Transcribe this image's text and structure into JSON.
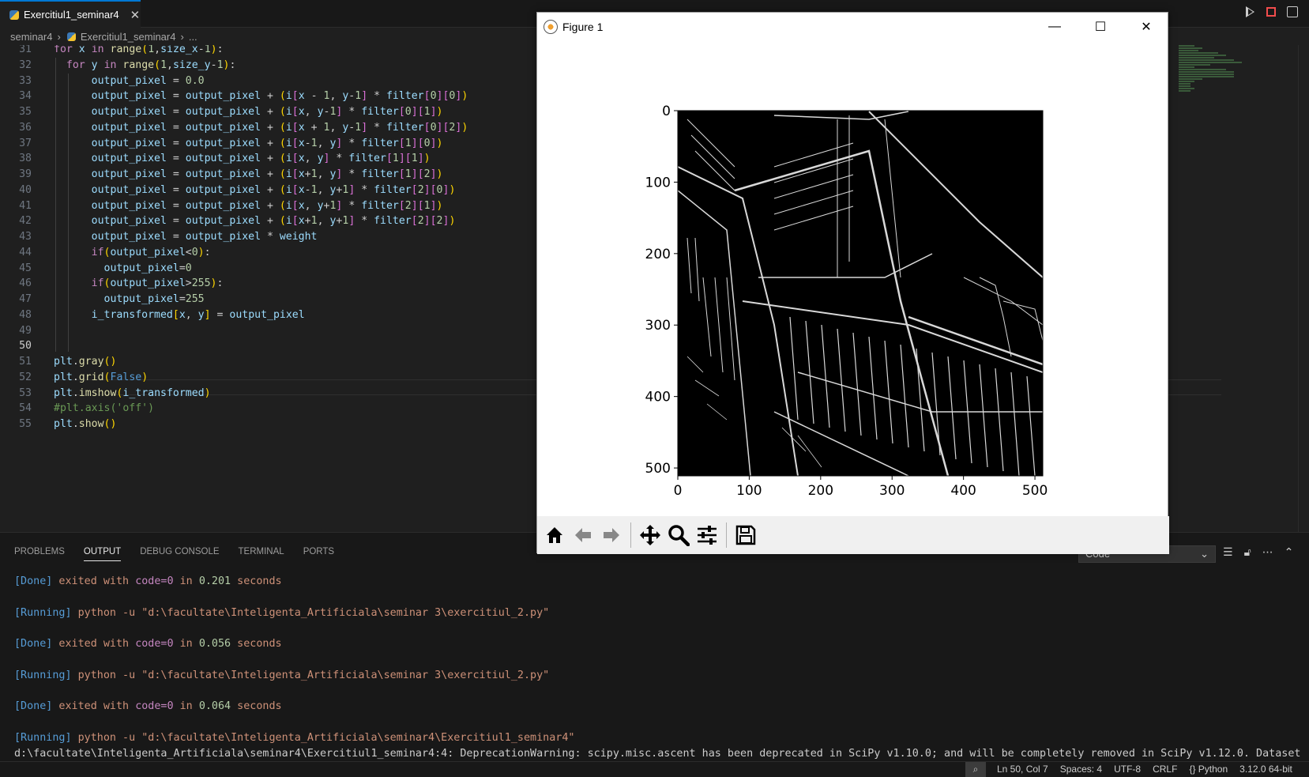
{
  "tab": {
    "label": "Exercitiul1_seminar4",
    "close": "✕"
  },
  "breadcrumbs": {
    "folder": "seminar4",
    "file": "Exercitiul1_seminar4",
    "more": "..."
  },
  "code_lines": [
    {
      "n": "31",
      "html": "<span class='k'>for</span> <span class='v'>x</span> <span class='k'>in</span> <span class='fn'>range</span><span class='p1'>(</span><span class='n'>1</span>,<span class='v'>size_x</span>-<span class='n'>1</span><span class='p1'>)</span>:"
    },
    {
      "n": "32",
      "html": "  <span class='k'>for</span> <span class='v'>y</span> <span class='k'>in</span> <span class='fn'>range</span><span class='p1'>(</span><span class='n'>1</span>,<span class='v'>size_y</span>-<span class='n'>1</span><span class='p1'>)</span>:"
    },
    {
      "n": "33",
      "html": "      <span class='v'>output_pixel</span> = <span class='n'>0.0</span>"
    },
    {
      "n": "34",
      "html": "      <span class='v'>output_pixel</span> = <span class='v'>output_pixel</span> + <span class='p1'>(</span><span class='v'>i</span><span class='p2'>[</span><span class='v'>x</span> - <span class='n'>1</span>, <span class='v'>y</span>-<span class='n'>1</span><span class='p2'>]</span> * <span class='v'>filter</span><span class='p2'>[</span><span class='n'>0</span><span class='p2'>][</span><span class='n'>0</span><span class='p2'>]</span><span class='p1'>)</span>"
    },
    {
      "n": "35",
      "html": "      <span class='v'>output_pixel</span> = <span class='v'>output_pixel</span> + <span class='p1'>(</span><span class='v'>i</span><span class='p2'>[</span><span class='v'>x</span>, <span class='v'>y</span>-<span class='n'>1</span><span class='p2'>]</span> * <span class='v'>filter</span><span class='p2'>[</span><span class='n'>0</span><span class='p2'>][</span><span class='n'>1</span><span class='p2'>]</span><span class='p1'>)</span>"
    },
    {
      "n": "36",
      "html": "      <span class='v'>output_pixel</span> = <span class='v'>output_pixel</span> + <span class='p1'>(</span><span class='v'>i</span><span class='p2'>[</span><span class='v'>x</span> + <span class='n'>1</span>, <span class='v'>y</span>-<span class='n'>1</span><span class='p2'>]</span> * <span class='v'>filter</span><span class='p2'>[</span><span class='n'>0</span><span class='p2'>][</span><span class='n'>2</span><span class='p2'>]</span><span class='p1'>)</span>"
    },
    {
      "n": "37",
      "html": "      <span class='v'>output_pixel</span> = <span class='v'>output_pixel</span> + <span class='p1'>(</span><span class='v'>i</span><span class='p2'>[</span><span class='v'>x</span>-<span class='n'>1</span>, <span class='v'>y</span><span class='p2'>]</span> * <span class='v'>filter</span><span class='p2'>[</span><span class='n'>1</span><span class='p2'>][</span><span class='n'>0</span><span class='p2'>]</span><span class='p1'>)</span>"
    },
    {
      "n": "38",
      "html": "      <span class='v'>output_pixel</span> = <span class='v'>output_pixel</span> + <span class='p1'>(</span><span class='v'>i</span><span class='p2'>[</span><span class='v'>x</span>, <span class='v'>y</span><span class='p2'>]</span> * <span class='v'>filter</span><span class='p2'>[</span><span class='n'>1</span><span class='p2'>][</span><span class='n'>1</span><span class='p2'>]</span><span class='p1'>)</span>"
    },
    {
      "n": "39",
      "html": "      <span class='v'>output_pixel</span> = <span class='v'>output_pixel</span> + <span class='p1'>(</span><span class='v'>i</span><span class='p2'>[</span><span class='v'>x</span>+<span class='n'>1</span>, <span class='v'>y</span><span class='p2'>]</span> * <span class='v'>filter</span><span class='p2'>[</span><span class='n'>1</span><span class='p2'>][</span><span class='n'>2</span><span class='p2'>]</span><span class='p1'>)</span>"
    },
    {
      "n": "40",
      "html": "      <span class='v'>output_pixel</span> = <span class='v'>output_pixel</span> + <span class='p1'>(</span><span class='v'>i</span><span class='p2'>[</span><span class='v'>x</span>-<span class='n'>1</span>, <span class='v'>y</span>+<span class='n'>1</span><span class='p2'>]</span> * <span class='v'>filter</span><span class='p2'>[</span><span class='n'>2</span><span class='p2'>][</span><span class='n'>0</span><span class='p2'>]</span><span class='p1'>)</span>"
    },
    {
      "n": "41",
      "html": "      <span class='v'>output_pixel</span> = <span class='v'>output_pixel</span> + <span class='p1'>(</span><span class='v'>i</span><span class='p2'>[</span><span class='v'>x</span>, <span class='v'>y</span>+<span class='n'>1</span><span class='p2'>]</span> * <span class='v'>filter</span><span class='p2'>[</span><span class='n'>2</span><span class='p2'>][</span><span class='n'>1</span><span class='p2'>]</span><span class='p1'>)</span>"
    },
    {
      "n": "42",
      "html": "      <span class='v'>output_pixel</span> = <span class='v'>output_pixel</span> + <span class='p1'>(</span><span class='v'>i</span><span class='p2'>[</span><span class='v'>x</span>+<span class='n'>1</span>, <span class='v'>y</span>+<span class='n'>1</span><span class='p2'>]</span> * <span class='v'>filter</span><span class='p2'>[</span><span class='n'>2</span><span class='p2'>][</span><span class='n'>2</span><span class='p2'>]</span><span class='p1'>)</span>"
    },
    {
      "n": "43",
      "html": "      <span class='v'>output_pixel</span> = <span class='v'>output_pixel</span> * <span class='v'>weight</span>"
    },
    {
      "n": "44",
      "html": "      <span class='k'>if</span><span class='p1'>(</span><span class='v'>output_pixel</span>&lt;<span class='n'>0</span><span class='p1'>)</span>:"
    },
    {
      "n": "45",
      "html": "        <span class='v'>output_pixel</span>=<span class='n'>0</span>"
    },
    {
      "n": "46",
      "html": "      <span class='k'>if</span><span class='p1'>(</span><span class='v'>output_pixel</span>&gt;<span class='n'>255</span><span class='p1'>)</span>:"
    },
    {
      "n": "47",
      "html": "        <span class='v'>output_pixel</span>=<span class='n'>255</span>"
    },
    {
      "n": "48",
      "html": "      <span class='v'>i_transformed</span><span class='p1'>[</span><span class='v'>x</span>, <span class='v'>y</span><span class='p1'>]</span> = <span class='v'>output_pixel</span>"
    },
    {
      "n": "49",
      "html": ""
    },
    {
      "n": "50",
      "html": "",
      "current": true
    },
    {
      "n": "51",
      "html": "<span class='v'>plt</span>.<span class='fn'>gray</span><span class='p1'>()</span>"
    },
    {
      "n": "52",
      "html": "<span class='v'>plt</span>.<span class='fn'>grid</span><span class='p1'>(</span><span class='k2'>False</span><span class='p1'>)</span>"
    },
    {
      "n": "53",
      "html": "<span class='v'>plt</span>.<span class='fn'>imshow</span><span class='p1'>(</span><span class='v'>i_transformed</span><span class='p1'>)</span>"
    },
    {
      "n": "54",
      "html": "<span class='cm'>#plt.axis('off')</span>"
    },
    {
      "n": "55",
      "html": "<span class='v'>plt</span>.<span class='fn'>show</span><span class='p1'>()</span>"
    }
  ],
  "panel": {
    "tabs": [
      "PROBLEMS",
      "OUTPUT",
      "DEBUG CONSOLE",
      "TERMINAL",
      "PORTS"
    ],
    "active_tab": "OUTPUT",
    "channel": "Code",
    "output": [
      {
        "kind": "done",
        "tag": "[Done]",
        "text": " exited with ",
        "code": "code=0",
        "in": " in ",
        "time": "0.201",
        "unit": " seconds"
      },
      {
        "kind": "run",
        "tag": "[Running]",
        "cmd": " python -u ",
        "path": "\"d:\\facultate\\Inteligenta_Artificiala\\seminar 3\\exercitiul_2.py\""
      },
      {
        "kind": "done",
        "tag": "[Done]",
        "text": " exited with ",
        "code": "code=0",
        "in": " in ",
        "time": "0.056",
        "unit": " seconds"
      },
      {
        "kind": "run",
        "tag": "[Running]",
        "cmd": " python -u ",
        "path": "\"d:\\facultate\\Inteligenta_Artificiala\\seminar 3\\exercitiul_2.py\""
      },
      {
        "kind": "done",
        "tag": "[Done]",
        "text": " exited with ",
        "code": "code=0",
        "in": " in ",
        "time": "0.064",
        "unit": " seconds"
      },
      {
        "kind": "run",
        "tag": "[Running]",
        "cmd": " python -u ",
        "path": "\"d:\\facultate\\Inteligenta_Artificiala\\seminar4\\Exercitiul1_seminar4\""
      },
      {
        "kind": "warn",
        "text": "d:\\facultate\\Inteligenta_Artificiala\\seminar4\\Exercitiul1_seminar4:4: DeprecationWarning: scipy.misc.ascent has been deprecated in SciPy v1.10.0; and will be completely removed in SciPy v1.12.0. Dataset"
      }
    ]
  },
  "statusbar": {
    "position": "Ln 50, Col 7",
    "spaces": "Spaces: 4",
    "encoding": "UTF-8",
    "eol": "CRLF",
    "language": "{} Python",
    "interpreter": "3.12.0 64-bit"
  },
  "figure": {
    "title": "Figure 1",
    "window_controls": [
      "—",
      "☐",
      "✕"
    ],
    "toolbar_icons": [
      "home-icon",
      "back-icon",
      "forward-icon",
      "pan-icon",
      "zoom-icon",
      "configure-subplots-icon",
      "save-icon"
    ]
  },
  "chart_data": {
    "type": "heatmap",
    "title": "",
    "xlabel": "",
    "ylabel": "",
    "x_ticks": [
      0,
      100,
      200,
      300,
      400,
      500
    ],
    "y_ticks": [
      0,
      100,
      200,
      300,
      400,
      500
    ],
    "xlim": [
      0,
      511
    ],
    "ylim": [
      511,
      0
    ],
    "colormap": "gray",
    "grid": false
  }
}
